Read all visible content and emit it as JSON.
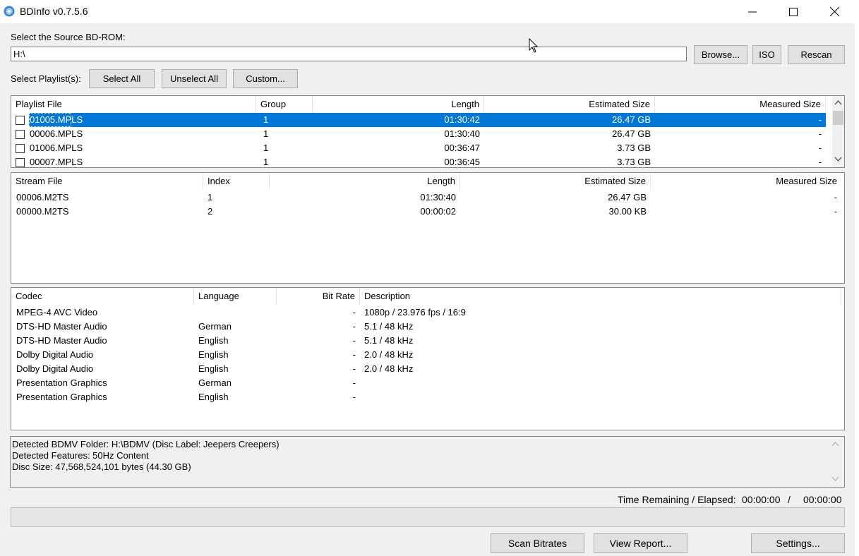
{
  "window": {
    "title": "BDInfo v0.7.5.6"
  },
  "source": {
    "label": "Select the Source BD-ROM:",
    "value": "H:\\",
    "browse": "Browse...",
    "iso": "ISO",
    "rescan": "Rescan"
  },
  "playlists_bar": {
    "label": "Select Playlist(s):",
    "select_all": "Select All",
    "unselect_all": "Unselect All",
    "custom": "Custom..."
  },
  "playlist_table": {
    "headers": [
      "Playlist File",
      "Group",
      "Length",
      "Estimated Size",
      "Measured Size"
    ],
    "rows": [
      {
        "file": "01005.MPLS",
        "group": "1",
        "length": "01:30:42",
        "est": "26.47 GB",
        "measured": "-"
      },
      {
        "file": "00006.MPLS",
        "group": "1",
        "length": "01:30:40",
        "est": "26.47 GB",
        "measured": "-"
      },
      {
        "file": "01006.MPLS",
        "group": "1",
        "length": "00:36:47",
        "est": "3.73 GB",
        "measured": "-"
      },
      {
        "file": "00007.MPLS",
        "group": "1",
        "length": "00:36:45",
        "est": "3.73 GB",
        "measured": "-"
      }
    ]
  },
  "stream_table": {
    "headers": [
      "Stream File",
      "Index",
      "Length",
      "Estimated Size",
      "Measured Size"
    ],
    "rows": [
      {
        "file": "00006.M2TS",
        "index": "1",
        "length": "01:30:40",
        "est": "26.47 GB",
        "measured": "-"
      },
      {
        "file": "00000.M2TS",
        "index": "2",
        "length": "00:00:02",
        "est": "30.00 KB",
        "measured": "-"
      }
    ]
  },
  "codec_table": {
    "headers": [
      "Codec",
      "Language",
      "Bit Rate",
      "Description"
    ],
    "rows": [
      {
        "codec": "MPEG-4 AVC Video",
        "language": "",
        "bitrate": "-",
        "desc": "1080p / 23.976 fps / 16:9"
      },
      {
        "codec": "DTS-HD Master Audio",
        "language": "German",
        "bitrate": "-",
        "desc": "5.1 / 48 kHz"
      },
      {
        "codec": "DTS-HD Master Audio",
        "language": "English",
        "bitrate": "-",
        "desc": "5.1 / 48 kHz"
      },
      {
        "codec": "Dolby Digital Audio",
        "language": "English",
        "bitrate": "-",
        "desc": "2.0 / 48 kHz"
      },
      {
        "codec": "Dolby Digital Audio",
        "language": "English",
        "bitrate": "-",
        "desc": "2.0 / 48 kHz"
      },
      {
        "codec": "Presentation Graphics",
        "language": "German",
        "bitrate": "-",
        "desc": ""
      },
      {
        "codec": "Presentation Graphics",
        "language": "English",
        "bitrate": "-",
        "desc": ""
      }
    ]
  },
  "log": {
    "lines": [
      "Detected BDMV Folder: H:\\BDMV (Disc Label: Jeepers Creepers)",
      "Detected Features: 50Hz Content",
      "Disc Size: 47,568,524,101 bytes (44.30 GB)"
    ]
  },
  "status": {
    "time_label": "Time Remaining / Elapsed:",
    "remaining": "00:00:00",
    "separator": "/",
    "elapsed": "00:00:00",
    "progress": 0
  },
  "buttons": {
    "scan": "Scan Bitrates",
    "report": "View Report...",
    "settings": "Settings..."
  },
  "colors": {
    "selection": "#0078d7",
    "window_bg": "#f0f0f0"
  }
}
